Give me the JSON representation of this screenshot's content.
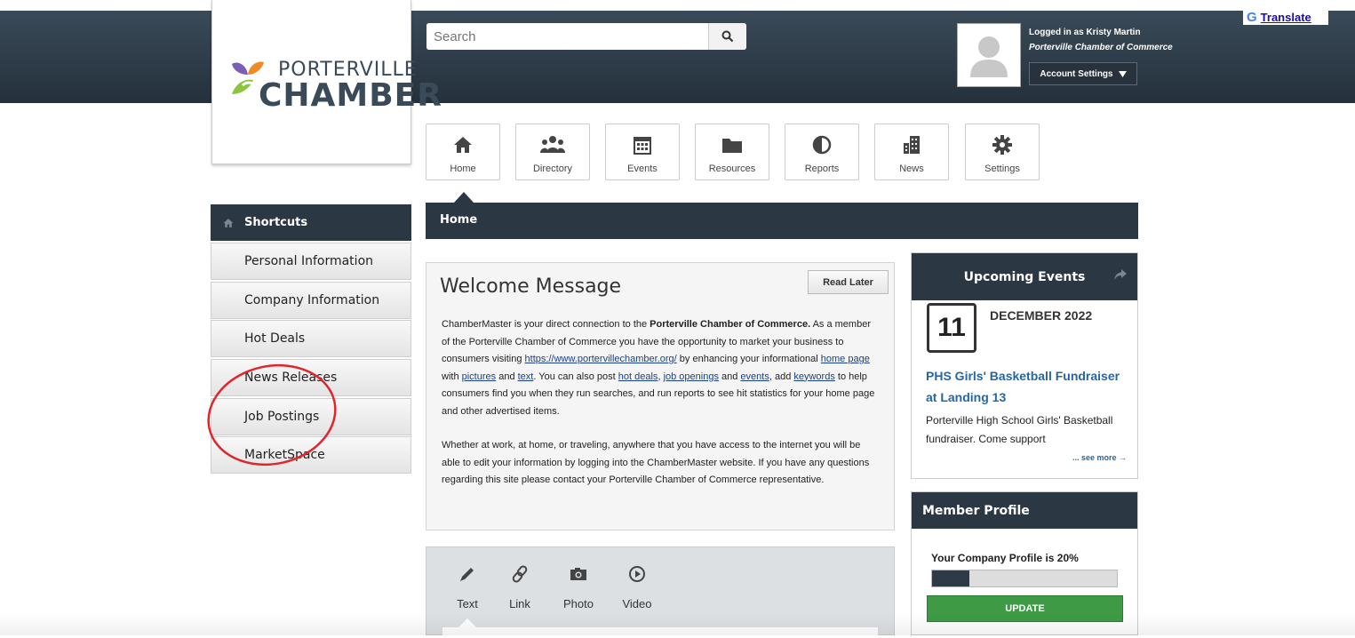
{
  "header": {
    "logo_line1": "PORTERVILLE",
    "logo_line2": "CHAMBER",
    "search_placeholder": "Search",
    "user": {
      "logged_in": "Logged in as Kristy Martin",
      "org": "Porterville Chamber of Commerce",
      "account_settings": "Account Settings"
    },
    "translate": "Translate"
  },
  "nav": [
    {
      "label": "Home",
      "icon": "home-icon"
    },
    {
      "label": "Directory",
      "icon": "directory-icon"
    },
    {
      "label": "Events",
      "icon": "calendar-icon"
    },
    {
      "label": "Resources",
      "icon": "folder-icon"
    },
    {
      "label": "Reports",
      "icon": "pie-chart-icon"
    },
    {
      "label": "News",
      "icon": "news-icon"
    },
    {
      "label": "Settings",
      "icon": "gear-icon"
    }
  ],
  "shortcuts": {
    "title": "Shortcuts",
    "items": [
      "Personal Information",
      "Company Information",
      "Hot Deals",
      "News Releases",
      "Job Postings",
      "MarketSpace"
    ]
  },
  "home": {
    "title": "Home",
    "welcome_title": "Welcome Message",
    "read_later": "Read Later",
    "p1": {
      "s1": "ChamberMaster is your direct connection to the ",
      "org": "Porterville Chamber of Commerce.",
      "s2": " As a member of the Porterville Chamber of Commerce you have the opportunity to market your business to consumers visiting ",
      "url": "https://www.portervillechamber.org/",
      "s3": " by enhancing your informational ",
      "home_page": "home page",
      "s4": " with ",
      "pictures": "pictures",
      "s5": " and ",
      "text": "text",
      "s6": ".  You can also post ",
      "hot_deals": "hot deals",
      "s7": ", ",
      "job_openings": "job openings",
      "s8": " and ",
      "events": "events",
      "s9": ", add ",
      "keywords": "keywords",
      "s10": " to help consumers find you when they run searches, and run reports to see hit statistics for your home page and other advertised items."
    },
    "p2": "Whether at work, at home, or traveling, anywhere that you have access to the internet you will be able to edit your information by logging into the ChamberMaster website.  If you have any questions regarding this site please contact your Porterville Chamber of Commerce representative."
  },
  "post_tabs": [
    {
      "label": "Text",
      "icon": "pencil-icon"
    },
    {
      "label": "Link",
      "icon": "link-icon"
    },
    {
      "label": "Photo",
      "icon": "camera-icon"
    },
    {
      "label": "Video",
      "icon": "play-icon"
    }
  ],
  "events": {
    "title": "Upcoming Events",
    "day": "11",
    "month_year": "DECEMBER 2022",
    "event_title": "PHS Girls' Basketball Fundraiser at Landing 13",
    "event_desc": "Porterville High School Girls' Basketball fundraiser. Come support",
    "see_more": "... see more →"
  },
  "profile": {
    "title": "Member Profile",
    "text": "Your Company Profile is 20%",
    "percent": 20,
    "update": "UPDATE"
  },
  "colors": {
    "header_dark": "#2b3742",
    "link": "#2466a8",
    "update_green": "#3e9a45",
    "annotation_red": "#e0262b"
  }
}
